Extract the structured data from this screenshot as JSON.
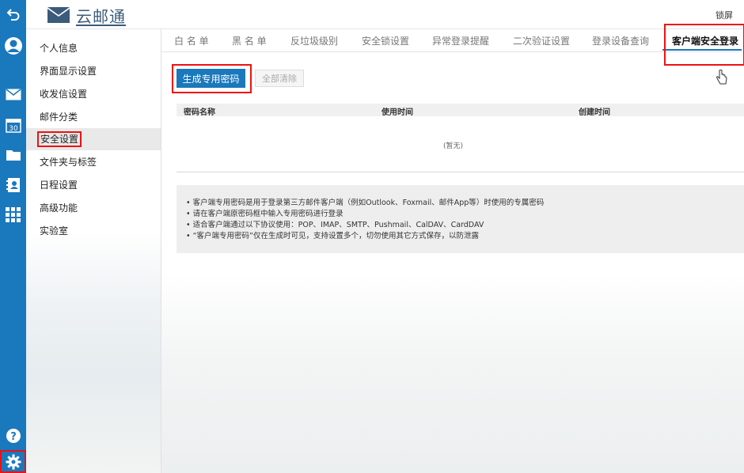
{
  "header": {
    "logo_text": "云邮通",
    "lock_label": "锁屏"
  },
  "sidebar_menu": [
    "个人信息",
    "界面显示设置",
    "收发信设置",
    "邮件分类",
    "安全设置",
    "文件夹与标签",
    "日程设置",
    "高级功能",
    "实验室"
  ],
  "tabs": [
    "白 名 单",
    "黑 名 单",
    "反垃圾级别",
    "安全锁设置",
    "异常登录提醒",
    "二次验证设置",
    "登录设备查询",
    "客户端安全登录"
  ],
  "actions": {
    "generate_label": "生成专用密码",
    "clear_label": "全部清除"
  },
  "table": {
    "columns": [
      "密码名称",
      "使用时间",
      "创建时间"
    ],
    "empty_text": "(暂无)"
  },
  "tips": [
    "客户端专用密码是用于登录第三方邮件客户端（例如Outlook、Foxmail、邮件App等）时使用的专属密码",
    "请在客户端原密码框中输入专用密码进行登录",
    "适合客户端通过以下协议使用：POP、IMAP、SMTP、Pushmail、CalDAV、CardDAV",
    "“客户端专用密码”仅在生成时可见，支持设置多个，切勿使用其它方式保存，以防泄露"
  ],
  "rail_icons": [
    "back-icon",
    "user-avatar-icon",
    "mail-icon",
    "calendar-icon",
    "folder-icon",
    "contacts-icon",
    "apps-grid-icon",
    "help-icon",
    "settings-gear-icon"
  ],
  "calendar_day": "30",
  "colors": {
    "accent": "#1a78bc",
    "highlight_box": "#ee1111"
  }
}
